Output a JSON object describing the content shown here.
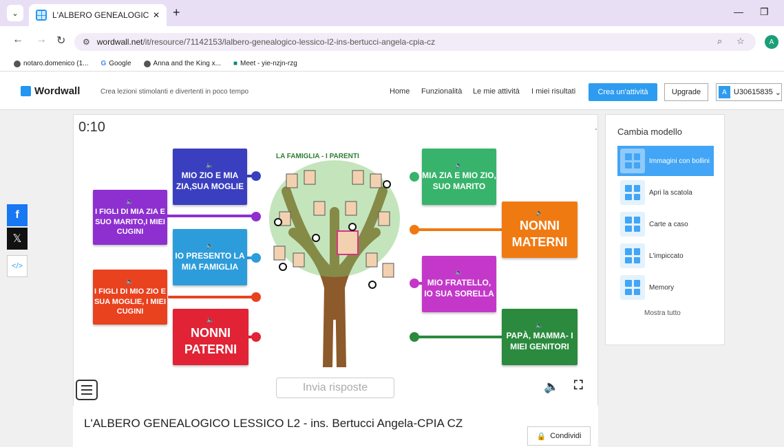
{
  "browser": {
    "tab_title": "L'ALBERO GENEALOGICO LESSI",
    "url_host": "wordwall.net",
    "url_path": "/it/resource/71142153/lalbero-genealogico-lessico-l2-ins-bertucci-angela-cpia-cz",
    "profile_initial": "A",
    "bookmarks": [
      "notaro.domenico (1...",
      "Google",
      "Anna and the King x...",
      "Meet - yie-nzjn-rzg"
    ]
  },
  "site": {
    "logo": "Wordwall",
    "tagline": "Crea lezioni stimolanti e divertenti in poco tempo",
    "nav": [
      "Home",
      "Funzionalità",
      "Le mie attività",
      "I miei risultati"
    ],
    "create_label": "Crea un'attività",
    "upgrade_label": "Upgrade",
    "user_initial": "A",
    "user_name": "U30615835"
  },
  "activity": {
    "timer": "0:10",
    "image_title": "LA FAMIGLIA - I PARENTI",
    "submit_label": "Invia risposte",
    "title": "L'ALBERO GENEALOGICO LESSICO L2 - ins. Bertucci Angela-CPIA CZ",
    "share_label": "Condividi",
    "cards": [
      {
        "text": "MIO ZIO E MIA ZIA,SUA MOGLIE",
        "color": "#3a3fbf"
      },
      {
        "text": "I FIGLI DI MIA ZIA E SUO MARITO,I MIEI CUGINI",
        "color": "#8e2fd0"
      },
      {
        "text": "IO PRESENTO LA MIA FAMIGLIA",
        "color": "#2d9cdb"
      },
      {
        "text": "I FIGLI DI MIO ZIO E SUA MOGLIE, I MIEI CUGINI",
        "color": "#e8421f"
      },
      {
        "text": "NONNI PATERNI",
        "color": "#e12335"
      },
      {
        "text": "MIA ZIA E MIO ZIO, SUO MARITO",
        "color": "#37b36b"
      },
      {
        "text": "NONNI MATERNI",
        "color": "#f07a12"
      },
      {
        "text": "MIO FRATELLO, IO SUA SORELLA",
        "color": "#c438c9"
      },
      {
        "text": "PAPÀ, MAMMA- I MIEI GENITORI",
        "color": "#2b8a3e"
      }
    ]
  },
  "sidebar": {
    "title": "Cambia modello",
    "templates": [
      "Immagini con bollini",
      "Apri la scatola",
      "Carte a caso",
      "L'impiccato",
      "Memory"
    ],
    "show_all": "Mostra tutto"
  }
}
